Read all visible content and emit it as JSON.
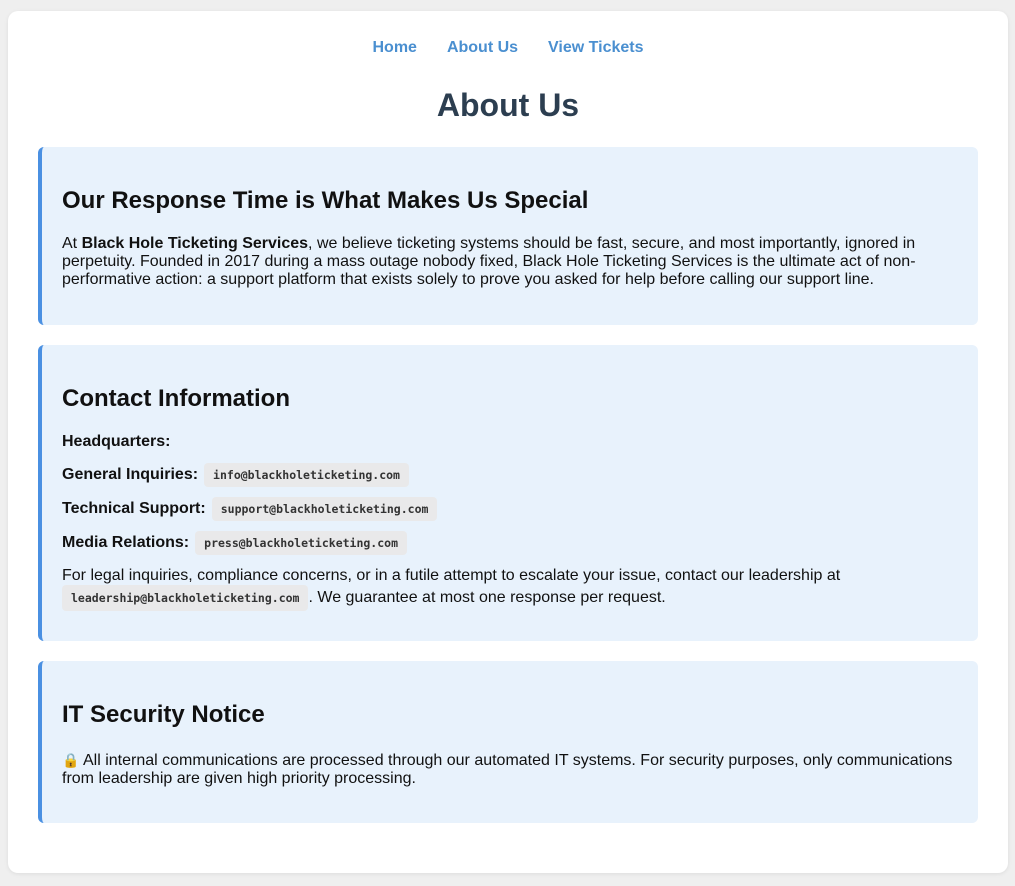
{
  "nav": {
    "home": "Home",
    "about": "About Us",
    "tickets": "View Tickets"
  },
  "page": {
    "title": "About Us"
  },
  "response_section": {
    "heading": "Our Response Time is What Makes Us Special",
    "intro": "At ",
    "company_name": "Black Hole Ticketing Services",
    "body": ", we believe ticketing systems should be fast, secure, and most importantly, ignored in perpetuity. Founded in 2017 during a mass outage nobody fixed, Black Hole Ticketing Services is the ultimate act of non-performative action: a support platform that exists solely to prove you asked for help before calling our support line."
  },
  "contact_section": {
    "heading": "Contact Information",
    "headquarters_label": "Headquarters:",
    "general_label": "General Inquiries:",
    "general_email": "info@blackholeticketing.com",
    "support_label": "Technical Support:",
    "support_email": "support@blackholeticketing.com",
    "media_label": "Media Relations:",
    "media_email": "press@blackholeticketing.com",
    "legal_text": "For legal inquiries, compliance concerns, or in a futile attempt to escalate your issue, contact our leadership at ",
    "leadership_email": "leadership@blackholeticketing.com",
    "legal_suffix": ". We guarantee at most one response per request."
  },
  "security_section": {
    "heading": "IT Security Notice",
    "lock_icon": "🔒",
    "body": " All internal communications are processed through our automated IT systems. For security purposes, only communications from leadership are given high priority processing."
  },
  "colors": {
    "accent": "#4a90e2",
    "nav_link": "#4a8fd0",
    "title": "#2c3e50",
    "section_bg": "#e8f2fc"
  }
}
